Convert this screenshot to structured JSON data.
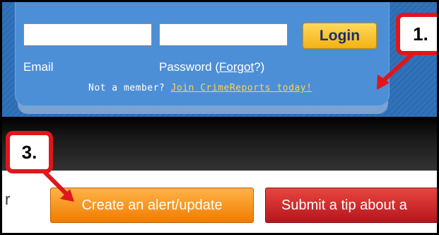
{
  "login": {
    "email_value": "",
    "password_value": "",
    "login_label": "Login",
    "email_label": "Email",
    "password_label": "Password (",
    "forgot_label": "Forgot",
    "password_label_end": "?)",
    "not_member_text": "Not a member? ",
    "join_label": "Join CrimeReports today!"
  },
  "actions": {
    "left_edge_text": "r",
    "create_alert_label": "Create an alert/update",
    "submit_tip_label": "Submit a tip about a"
  },
  "annotations": {
    "callout_1": "1.",
    "callout_3": "3."
  },
  "colors": {
    "panel_blue": "#4d8fd6",
    "login_yellow": "#f3b215",
    "alert_orange": "#f07c00",
    "tip_red": "#b4161c",
    "annotation_red": "#e0161c"
  }
}
